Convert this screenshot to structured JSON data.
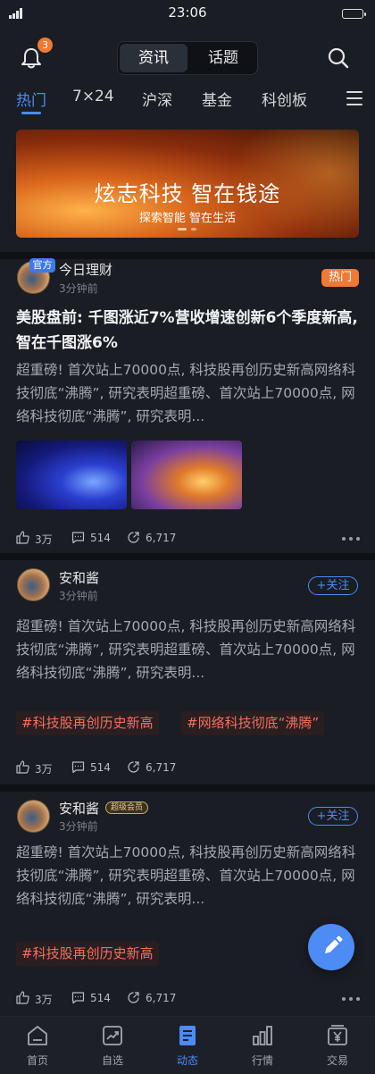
{
  "status_bar": {
    "time": "23:06"
  },
  "top_nav": {
    "notification_count": "3",
    "segments": [
      "资讯",
      "话题"
    ],
    "active_segment": "资讯"
  },
  "categories": {
    "items": [
      "热门",
      "7×24",
      "沪深",
      "基金",
      "科创板"
    ],
    "active": "热门"
  },
  "banner": {
    "title": "炫志科技 智在钱途",
    "subtitle": "探索智能 智在生活"
  },
  "posts": [
    {
      "avatar_tag": "官方",
      "author": "今日理财",
      "time": "3分钟前",
      "badge": "热门",
      "headline": "美股盘前: 千图涨近7%营收增速创新6个季度新高, 智在千图涨6%",
      "body": "超重磅! 首次站上70000点, 科技股再创历史新高网络科技彻底“沸腾”, 研究表明超重磅、首次站上70000点, 网络科技彻底“沸腾”, 研究表明...",
      "likes": "3万",
      "comments": "514",
      "shares": "6,717"
    },
    {
      "author": "安和酱",
      "time": "3分钟前",
      "follow_label": "+关注",
      "body": "超重磅! 首次站上70000点, 科技股再创历史新高网络科技彻底“沸腾”, 研究表明超重磅、首次站上70000点, 网络科技彻底“沸腾”, 研究表明...",
      "hashtags": [
        "#科技股再创历史新高",
        "#网络科技彻底“沸腾”"
      ],
      "likes": "3万",
      "comments": "514",
      "shares": "6,717"
    },
    {
      "author": "安和酱",
      "vip_label": "超级会员",
      "time": "3分钟前",
      "follow_label": "+关注",
      "body": "超重磅! 首次站上70000点, 科技股再创历史新高网络科技彻底“沸腾”, 研究表明超重磅、首次站上70000点, 网络科技彻底“沸腾”, 研究表明...",
      "hashtags": [
        "#科技股再创历史新高"
      ],
      "likes": "3万",
      "comments": "514",
      "shares": "6,717"
    }
  ],
  "tab_bar": {
    "items": [
      {
        "label": "首页",
        "icon": "home-icon"
      },
      {
        "label": "自选",
        "icon": "trend-icon"
      },
      {
        "label": "动态",
        "icon": "feed-icon"
      },
      {
        "label": "行情",
        "icon": "bar-chart-icon"
      },
      {
        "label": "交易",
        "icon": "yen-icon"
      }
    ],
    "active": "动态"
  },
  "colors": {
    "accent": "#4d8bf5",
    "hot": "#f07a33",
    "hashtag": "#f2705e",
    "background": "#15181f",
    "card": "#1a1d24"
  }
}
